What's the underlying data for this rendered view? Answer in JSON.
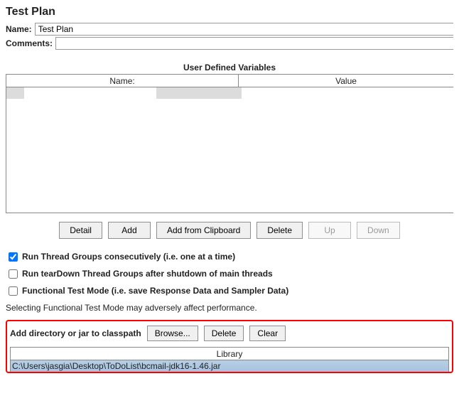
{
  "header": {
    "title": "Test Plan"
  },
  "fields": {
    "name_label": "Name:",
    "name_value": "Test Plan",
    "comments_label": "Comments:",
    "comments_value": ""
  },
  "variables": {
    "section_title": "User Defined Variables",
    "col_name": "Name:",
    "col_value": "Value"
  },
  "var_buttons": {
    "detail": "Detail",
    "add": "Add",
    "add_clipboard": "Add from Clipboard",
    "delete": "Delete",
    "up": "Up",
    "down": "Down"
  },
  "checks": {
    "consecutively": "Run Thread Groups consecutively (i.e. one at a time)",
    "teardown": "Run tearDown Thread Groups after shutdown of main threads",
    "functional": "Functional Test Mode (i.e. save Response Data and Sampler Data)",
    "note": "Selecting Functional Test Mode may adversely affect performance."
  },
  "classpath": {
    "label": "Add directory or jar to classpath",
    "browse": "Browse...",
    "delete": "Delete",
    "clear": "Clear",
    "lib_header": "Library",
    "lib_entry": "C:\\Users\\jasgia\\Desktop\\ToDoList\\bcmail-jdk16-1.46.jar"
  }
}
